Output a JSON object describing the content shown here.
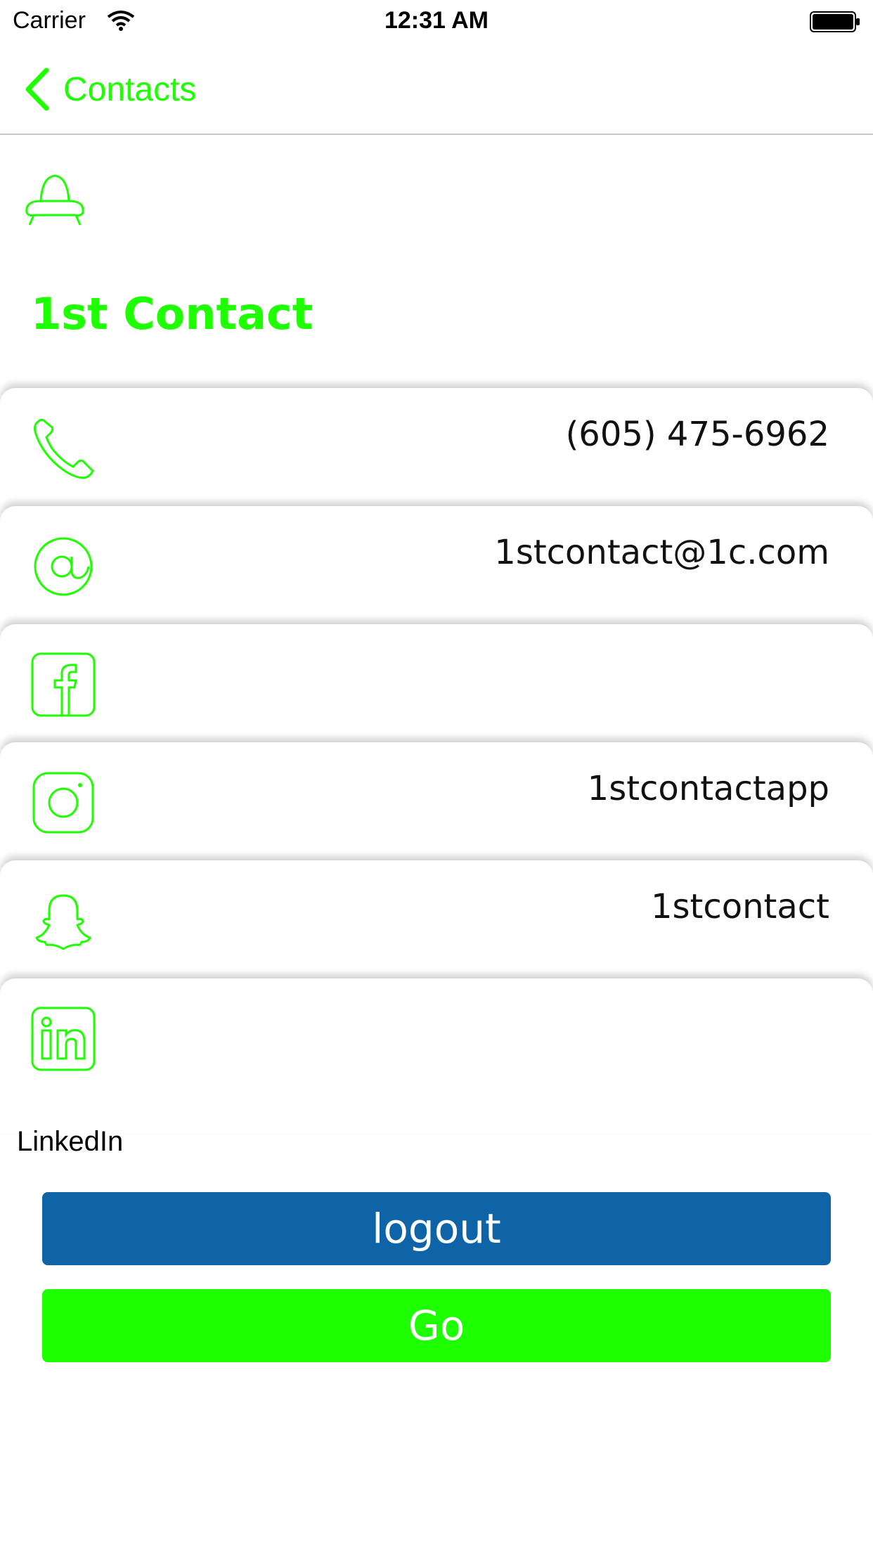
{
  "status_bar": {
    "carrier": "Carrier",
    "time": "12:31 AM",
    "wifi_icon": "wifi-icon",
    "battery_icon": "battery-icon"
  },
  "nav": {
    "back_label": "Contacts",
    "back_icon": "chevron-left-icon",
    "accent_color": "#1EFF00"
  },
  "header": {
    "logo_icon": "ufo-icon",
    "name": "1st Contact"
  },
  "rows": [
    {
      "icon": "phone-icon",
      "value": "(605) 475-6962"
    },
    {
      "icon": "at-sign-icon",
      "value": "1stcontact@1c.com"
    },
    {
      "icon": "facebook-icon",
      "value": ""
    },
    {
      "icon": "instagram-icon",
      "value": "1stcontactapp"
    },
    {
      "icon": "snapchat-icon",
      "value": "1stcontact"
    },
    {
      "icon": "linkedin-icon",
      "value": ""
    }
  ],
  "linkedin_label": "LinkedIn",
  "buttons": {
    "logout_label": "logout",
    "go_label": "Go",
    "logout_color": "#0F64A8",
    "go_color": "#1EFF00"
  }
}
